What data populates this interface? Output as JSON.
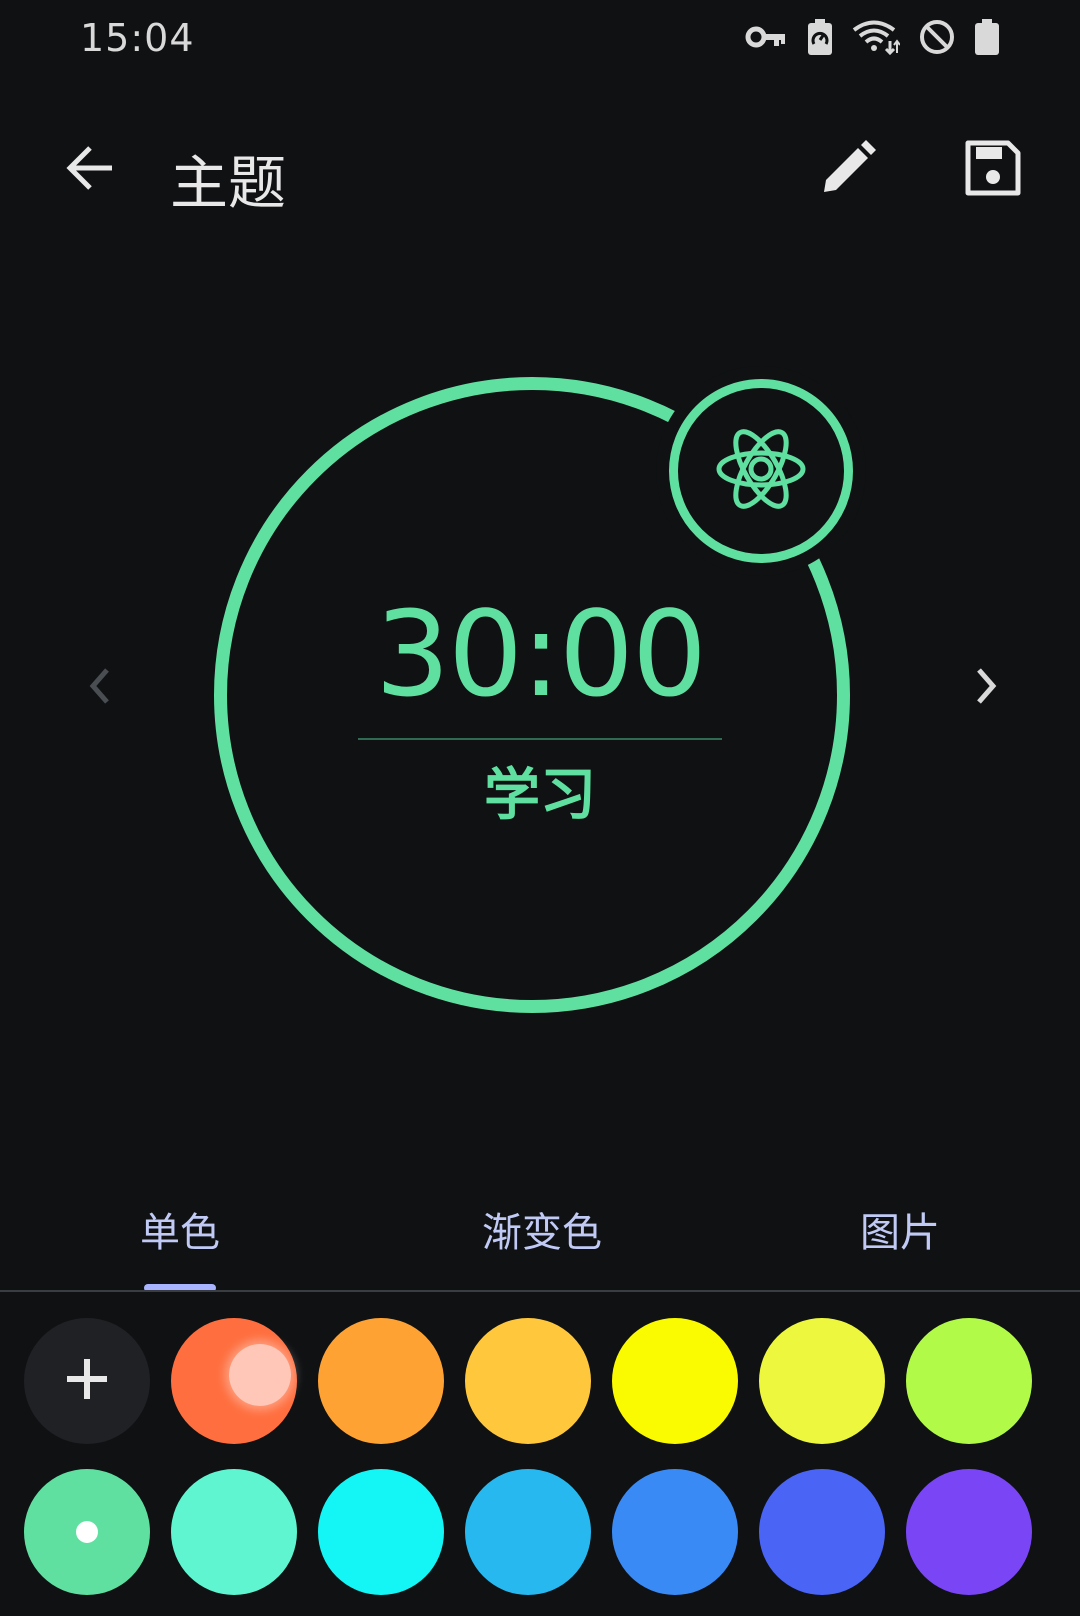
{
  "status_bar": {
    "time": "15:04",
    "icons": [
      "vpn-key-icon",
      "battery-saver-icon",
      "wifi-icon",
      "do-not-disturb-icon",
      "battery-icon"
    ]
  },
  "app_bar": {
    "title": "主题",
    "back_icon": "arrow-back-icon",
    "edit_icon": "pencil-icon",
    "save_icon": "floppy-disk-icon"
  },
  "preview": {
    "time": "30:00",
    "label": "学习",
    "badge_icon": "atom-icon",
    "accent_color": "#5fe0a0"
  },
  "tabs": [
    {
      "label": "单色",
      "selected": true
    },
    {
      "label": "渐变色",
      "selected": false
    },
    {
      "label": "图片",
      "selected": false
    }
  ],
  "colors": {
    "row1": [
      "#ff6e3e",
      "#ffa234",
      "#ffc83c",
      "#fafa00",
      "#edf73e",
      "#b2fa48"
    ],
    "row2": [
      "#5fe0a0",
      "#5ff5d0",
      "#14f5f5",
      "#28b8f0",
      "#3a8af5",
      "#4a64f5",
      "#7a46f5"
    ],
    "selected": "#5fe0a0"
  }
}
